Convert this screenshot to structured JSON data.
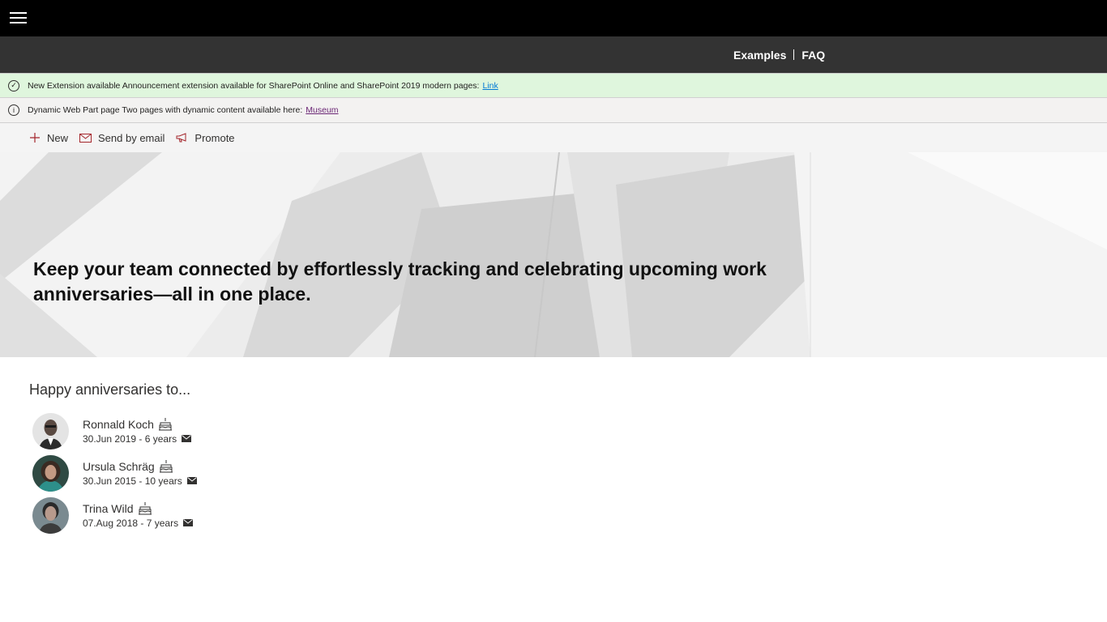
{
  "nav": {
    "links": [
      "Examples",
      "FAQ"
    ]
  },
  "banners": [
    {
      "text": "New Extension available Announcement extension available for SharePoint Online and SharePoint 2019 modern pages:",
      "link": "Link"
    },
    {
      "text": "Dynamic Web Part page Two pages with dynamic content available here:",
      "link": "Museum"
    }
  ],
  "commands": {
    "new": "New",
    "send_email": "Send by email",
    "promote": "Promote"
  },
  "hero": {
    "title": "Keep your team connected by effortlessly tracking and celebrating upcoming work anniversaries—all in one place."
  },
  "anniversaries": {
    "heading": "Happy anniversaries to...",
    "people": [
      {
        "name": "Ronnald Koch",
        "date": "30.Jun 2019 - 6 years"
      },
      {
        "name": "Ursula Schräg",
        "date": "30.Jun 2015 - 10 years"
      },
      {
        "name": "Trina Wild",
        "date": "07.Aug 2018 - 7 years"
      }
    ]
  },
  "icons": {
    "menu": "hamburger-menu-icon",
    "success": "checkmark-circle-icon",
    "info": "info-icon",
    "new": "plus-icon",
    "email": "mail-icon",
    "promote": "megaphone-icon",
    "cake": "cake-icon"
  },
  "colors": {
    "topbar": "#000000",
    "navbar": "#333333",
    "success_banner": "#dff6dd",
    "accent": "#a4262c"
  }
}
